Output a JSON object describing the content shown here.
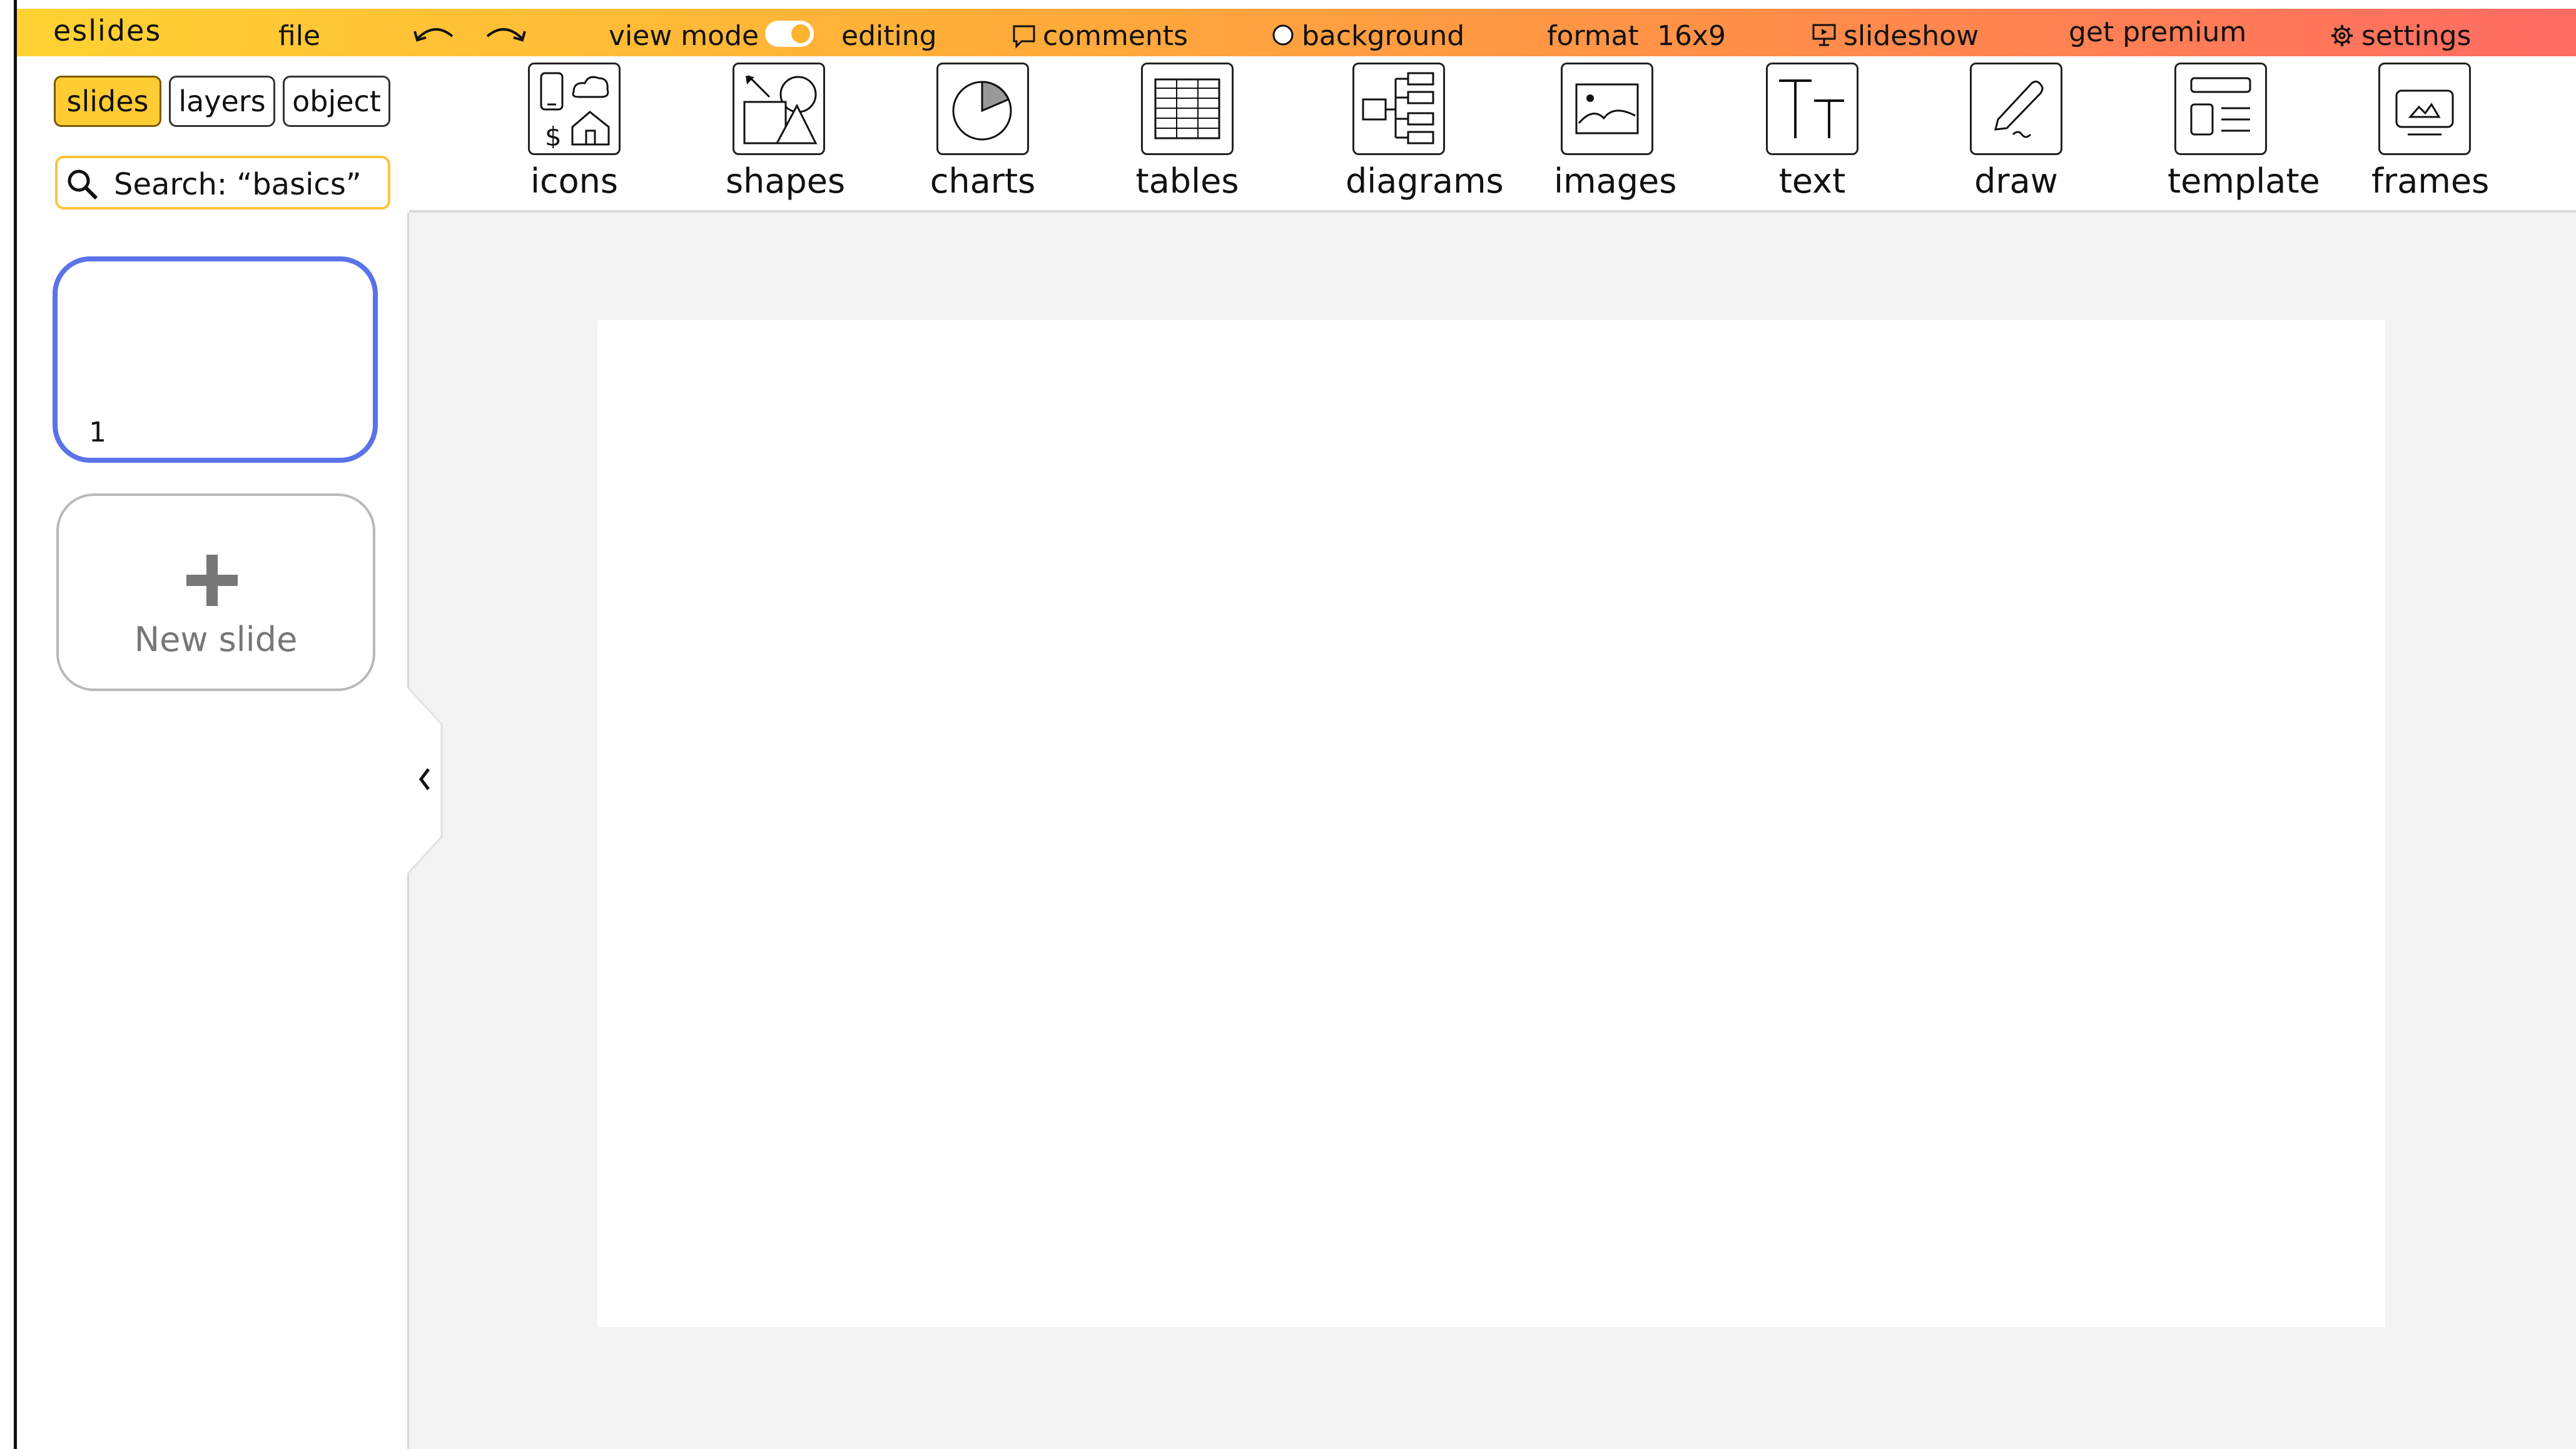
{
  "app": {
    "logo": "eslides"
  },
  "menu": {
    "file": "file",
    "view_mode": "view mode",
    "editing": "editing",
    "comments": "comments",
    "background": "background",
    "format": "format",
    "format_value": "16x9",
    "slideshow": "slideshow",
    "premium": "get premium",
    "settings": "settings"
  },
  "tabs": {
    "slides": "slides",
    "layers": "layers",
    "object": "object",
    "active": "slides"
  },
  "search": {
    "value": "Search: “basics”"
  },
  "toolbar": [
    {
      "label": "icons",
      "icon": "icons-icon"
    },
    {
      "label": "shapes",
      "icon": "shapes-icon"
    },
    {
      "label": "charts",
      "icon": "chart-icon"
    },
    {
      "label": "tables",
      "icon": "table-icon"
    },
    {
      "label": "diagrams",
      "icon": "diagram-icon"
    },
    {
      "label": "images",
      "icon": "image-icon"
    },
    {
      "label": "text",
      "icon": "text-icon"
    },
    {
      "label": "draw",
      "icon": "pen-icon"
    },
    {
      "label": "template",
      "icon": "template-icon"
    },
    {
      "label": "frames",
      "icon": "frame-icon"
    }
  ],
  "slides": [
    {
      "number": "1"
    }
  ],
  "new_slide": {
    "label": "New slide"
  },
  "colors": {
    "topbar_gradient": [
      "#ffd233",
      "#ff6b63"
    ],
    "active_tab": "#ffcc33",
    "selected_slide_border": "#5b73e8",
    "search_border": "#ffc439"
  }
}
